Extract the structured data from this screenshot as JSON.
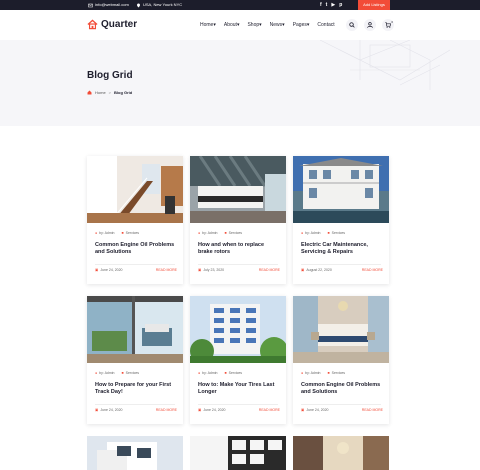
{
  "topbar": {
    "email": "info@webmail.com",
    "address": "USA, New Yourk NYC",
    "social_icons": [
      "facebook-icon",
      "twitter-icon",
      "youtube-icon",
      "pinterest-icon"
    ],
    "cta_label": "Add Listings"
  },
  "header": {
    "logo_text": "Quarter",
    "nav": [
      "Home",
      "About",
      "Shop",
      "News",
      "Pages",
      "Contact"
    ],
    "nav_dropdown": [
      true,
      true,
      true,
      true,
      true,
      false
    ],
    "cart_count": "0"
  },
  "hero": {
    "title": "Blog Grid",
    "breadcrumb_home": "Home",
    "breadcrumb_sep": ">",
    "breadcrumb_current": "Blog Grid"
  },
  "colors": {
    "accent": "#f24c38",
    "dark": "#1c1d2b",
    "hero_bg": "#f6f6f9"
  },
  "posts": [
    {
      "author": "by: Admin",
      "tag": "Services",
      "title": "Common Engine Oil Problems and Solutions",
      "date": "June 24, 2020",
      "read_more": "READ MORE"
    },
    {
      "author": "by: Admin",
      "tag": "Services",
      "title": "How and when to replace brake rotors",
      "date": "July 23, 2020",
      "read_more": "READ MORE"
    },
    {
      "author": "by: Admin",
      "tag": "Services",
      "title": "Electric Car Maintenance, Servicing & Repairs",
      "date": "August 22, 2020",
      "read_more": "READ MORE"
    },
    {
      "author": "by: Admin",
      "tag": "Services",
      "title": "How to Prepare for your First Track Day!",
      "date": "June 24, 2020",
      "read_more": "READ MORE"
    },
    {
      "author": "by: Admin",
      "tag": "Services",
      "title": "How to: Make Your Tires Last Longer",
      "date": "June 24, 2020",
      "read_more": "READ MORE"
    },
    {
      "author": "by: Admin",
      "tag": "Services",
      "title": "Common Engine Oil Problems and Solutions",
      "date": "June 24, 2020",
      "read_more": "READ MORE"
    }
  ]
}
